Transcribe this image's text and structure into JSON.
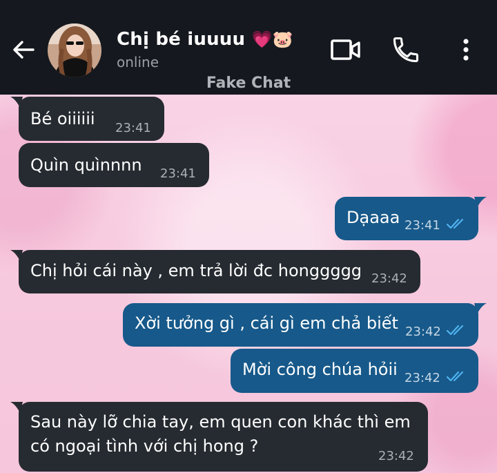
{
  "header": {
    "contact_name": "Chị bé iuuuu",
    "contact_emoji": "💗🐷",
    "status": "online",
    "watermark": "Fake Chat",
    "icons": [
      "back-arrow-icon",
      "video-call-icon",
      "phone-icon",
      "more-vertical-icon"
    ]
  },
  "colors": {
    "header_bg": "#15191f",
    "incoming_bubble": "#262b31",
    "outgoing_bubble": "#17598a",
    "read_tick": "#4fb3f0"
  },
  "messages": [
    {
      "direction": "in",
      "text": "Bé oiiiiii",
      "time": "23:41"
    },
    {
      "direction": "in",
      "text": "Quìn quìnnnn",
      "time": "23:41"
    },
    {
      "direction": "out",
      "text": "Dạaaa",
      "time": "23:41",
      "read": true
    },
    {
      "direction": "in",
      "text": "Chị hỏi cái này , em trả lời đc honggggg",
      "time": "23:42"
    },
    {
      "direction": "out",
      "text": "Xời tưởng gì , cái gì em chả biết",
      "time": "23:42",
      "read": true
    },
    {
      "direction": "out",
      "text": "Mời công chúa hỏii",
      "time": "23:42",
      "read": true
    },
    {
      "direction": "in",
      "text_line1": "Sau này lỡ chia tay, em quen con khác thì em",
      "text_line2": "có ngoại tình với chị hong ?",
      "time": "23:42"
    }
  ]
}
